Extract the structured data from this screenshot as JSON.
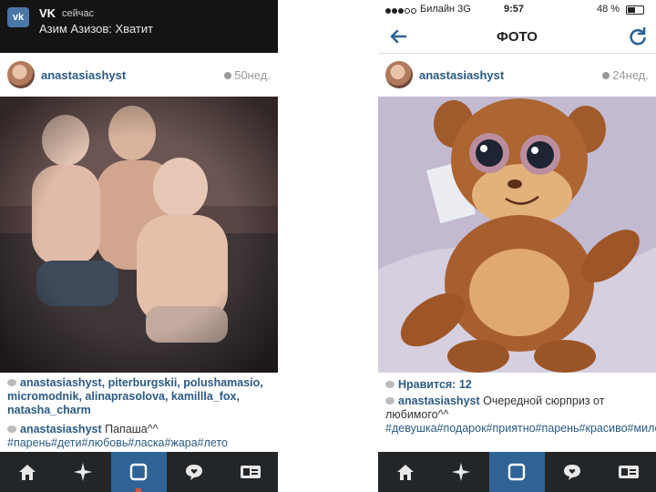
{
  "left_screen": {
    "notification": {
      "app": "VK",
      "time": "сейчас",
      "message": "Азим Азизов: Хватит"
    },
    "post": {
      "username": "anastasiashyst",
      "age": "50нед.",
      "tagged_users": "anastasiashyst, piterburgskii, polushamasio, micromodnik, alinaprasolova, kamillla_fox, natasha_charm",
      "caption_user": "anastasiashyst",
      "caption_text": "Папаша^^",
      "hashtags": "#парень#дети#любовь#ласка#жара#лето"
    }
  },
  "right_screen": {
    "status_bar": {
      "carrier": "Билайн 3G",
      "time": "9:57",
      "battery": "48 %",
      "battery_level": 0.48
    },
    "nav": {
      "title": "ФОТО"
    },
    "post": {
      "username": "anastasiashyst",
      "age": "24нед.",
      "likes": "Нравится: 12",
      "caption_user": "anastasiashyst",
      "caption_text": "Очередной сюрприз от любимого^^",
      "hashtags": "#девушка#подарок#приятно#парень#красиво#мило#игрушка#сюрприз#instagood#i"
    }
  },
  "tabbar": {
    "items": [
      "home-icon",
      "explore-icon",
      "camera-icon",
      "activity-icon",
      "profile-icon"
    ],
    "active_index": 2
  },
  "colors": {
    "link": "#2b5a87",
    "tabbar_bg": "#222629",
    "tab_active": "#2f6395",
    "notification_bg": "#141414"
  }
}
